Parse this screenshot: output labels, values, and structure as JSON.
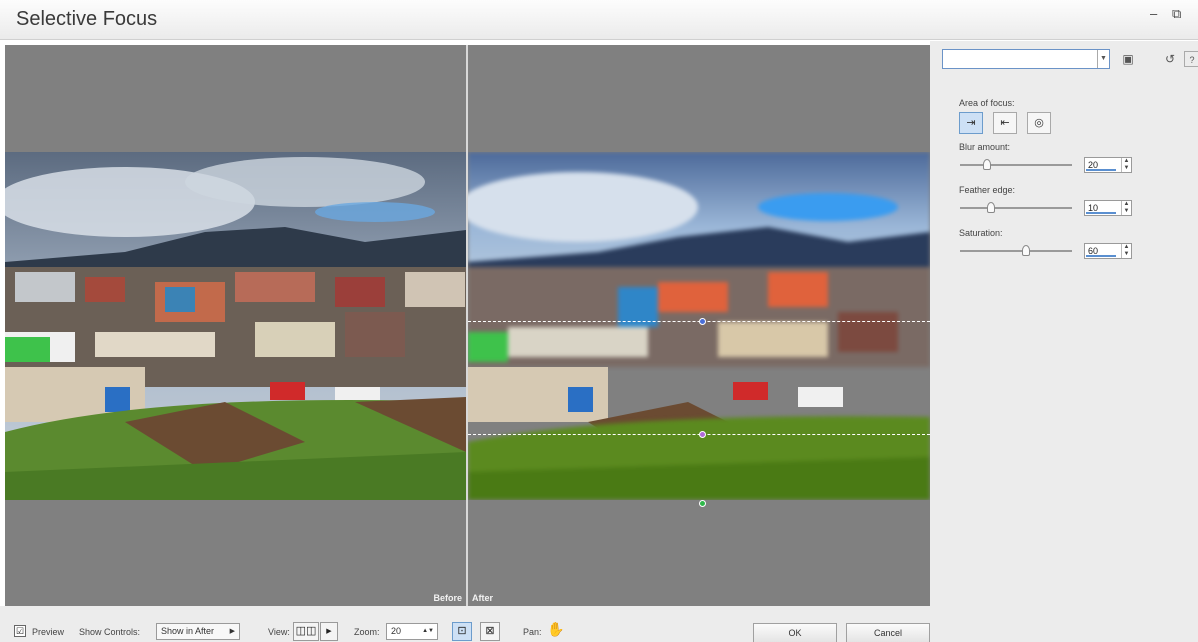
{
  "window": {
    "title": "Selective Focus",
    "minimize_glyph": "–",
    "restore_glyph": "⧉"
  },
  "canvas": {
    "before_label": "Before",
    "after_label": "After",
    "icons": [
      "guide-handle-top",
      "guide-handle-center",
      "guide-handle-bottom"
    ]
  },
  "settings": {
    "preset_value": "",
    "area_of_focus_label": "Area of focus:",
    "focus_modes": [
      {
        "name": "rectangle",
        "glyph": "⇥",
        "active": true
      },
      {
        "name": "line",
        "glyph": "⇤",
        "active": false
      },
      {
        "name": "circle",
        "glyph": "◎",
        "active": false
      }
    ],
    "blur_amount_label": "Blur amount:",
    "blur_amount": "20",
    "blur_amount_level": 0.22,
    "feather_edge_label": "Feather edge:",
    "feather_edge": "10",
    "feather_edge_level": 0.26,
    "saturation_label": "Saturation:",
    "saturation": "60",
    "saturation_level": 0.6
  },
  "bottom_bar": {
    "preview_label": "Preview",
    "preview_checked": "☑",
    "show_controls_label": "Show Controls:",
    "show_controls_value": "Show in After",
    "view_label": "View:",
    "zoom_label": "Zoom:",
    "zoom_value": "20",
    "pan_label": "Pan:",
    "ok_label": "OK",
    "cancel_label": "Cancel"
  },
  "colors": {
    "accent": "#5a8fd0",
    "workspace": "#808080",
    "panel": "#ececec"
  }
}
